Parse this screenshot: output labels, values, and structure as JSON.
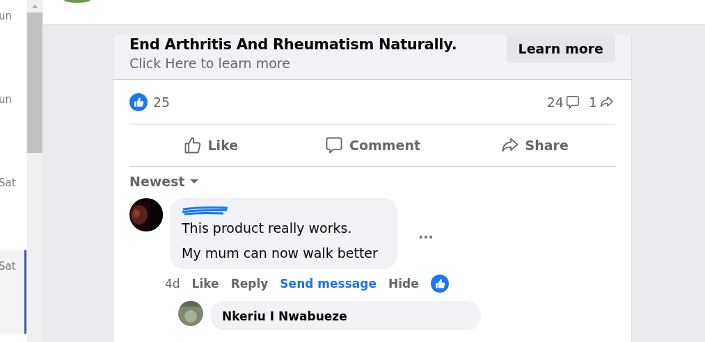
{
  "sidebar": {
    "items": [
      {
        "label": "un",
        "selected": false
      },
      {
        "label": "un",
        "selected": false
      },
      {
        "label": "Sat",
        "selected": false
      },
      {
        "label": "Sat",
        "selected": true
      }
    ]
  },
  "ad": {
    "headline": "End Arthritis And Rheumatism Naturally.",
    "subtitle": "Click Here to learn more",
    "button": "Learn more"
  },
  "stats": {
    "likes": "25",
    "comments": "24",
    "shares": "1"
  },
  "actions": [
    {
      "kind": "like",
      "label": "Like"
    },
    {
      "kind": "comment",
      "label": "Comment"
    },
    {
      "kind": "share",
      "label": "Share"
    }
  ],
  "sort": {
    "label": "Newest"
  },
  "comment": {
    "lines": [
      "This product really works.",
      "My mum can now walk better"
    ],
    "time": "4d",
    "actions": [
      {
        "label": "Like",
        "kind": "plain"
      },
      {
        "label": "Reply",
        "kind": "plain"
      },
      {
        "label": "Send message",
        "kind": "link"
      },
      {
        "label": "Hide",
        "kind": "plain"
      }
    ],
    "more": "..."
  },
  "reply": {
    "author": "Nkeriu I Nwabueze"
  }
}
